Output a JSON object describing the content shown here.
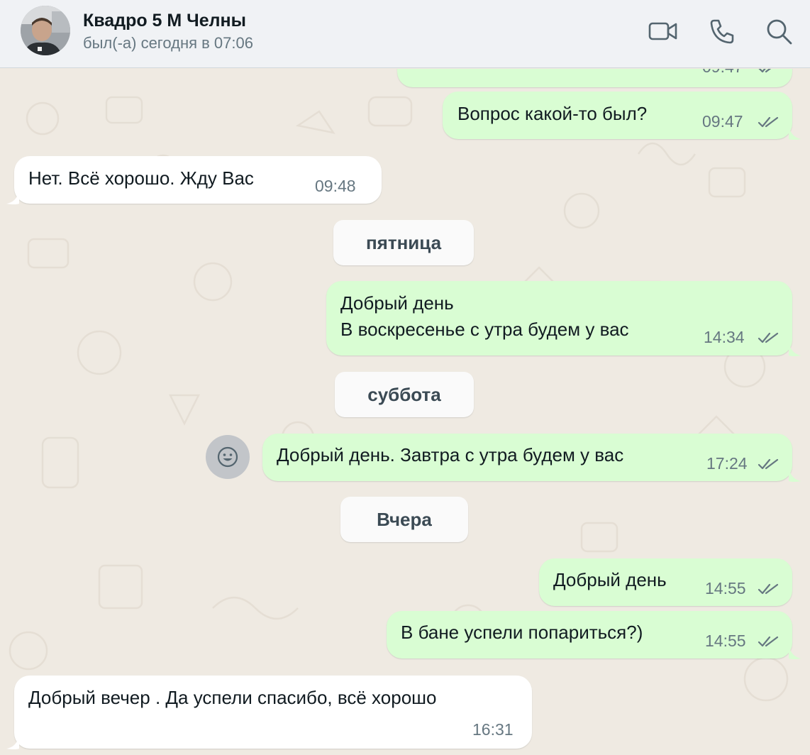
{
  "header": {
    "name": "Квадро 5 М Челны",
    "status": "был(-а) сегодня в 07:06",
    "icons": [
      "video-call-icon",
      "phone-icon",
      "search-icon"
    ]
  },
  "messages": [
    {
      "dir": "out",
      "text": "",
      "time": "09:47",
      "read": true
    },
    {
      "dir": "out",
      "text": "Вопрос какой-то был?",
      "time": "09:47",
      "read": true
    },
    {
      "dir": "in",
      "text": "Нет. Всё хорошо. Жду Вас",
      "time": "09:48"
    },
    {
      "dir": "date",
      "text": "пятница"
    },
    {
      "dir": "out",
      "text": "Добрый день\nВ воскресенье с утра будем у вас",
      "time": "14:34",
      "read": true
    },
    {
      "dir": "date",
      "text": "суббота"
    },
    {
      "dir": "out",
      "text": "Добрый день. Завтра с утра будем у вас",
      "time": "17:24",
      "read": true
    },
    {
      "dir": "date",
      "text": "Вчера"
    },
    {
      "dir": "out",
      "text": "Добрый день",
      "time": "14:55",
      "read": true
    },
    {
      "dir": "out",
      "text": "В бане успели попариться?)",
      "time": "14:55",
      "read": true
    },
    {
      "dir": "in",
      "text": "Добрый вечер . Да успели спасибо, всё хорошо",
      "time": "16:31"
    }
  ],
  "colors": {
    "background": "#efeae2",
    "outgoing_bubble": "#d9fdd3",
    "incoming_bubble": "#ffffff",
    "read_ticks": "#667781"
  }
}
